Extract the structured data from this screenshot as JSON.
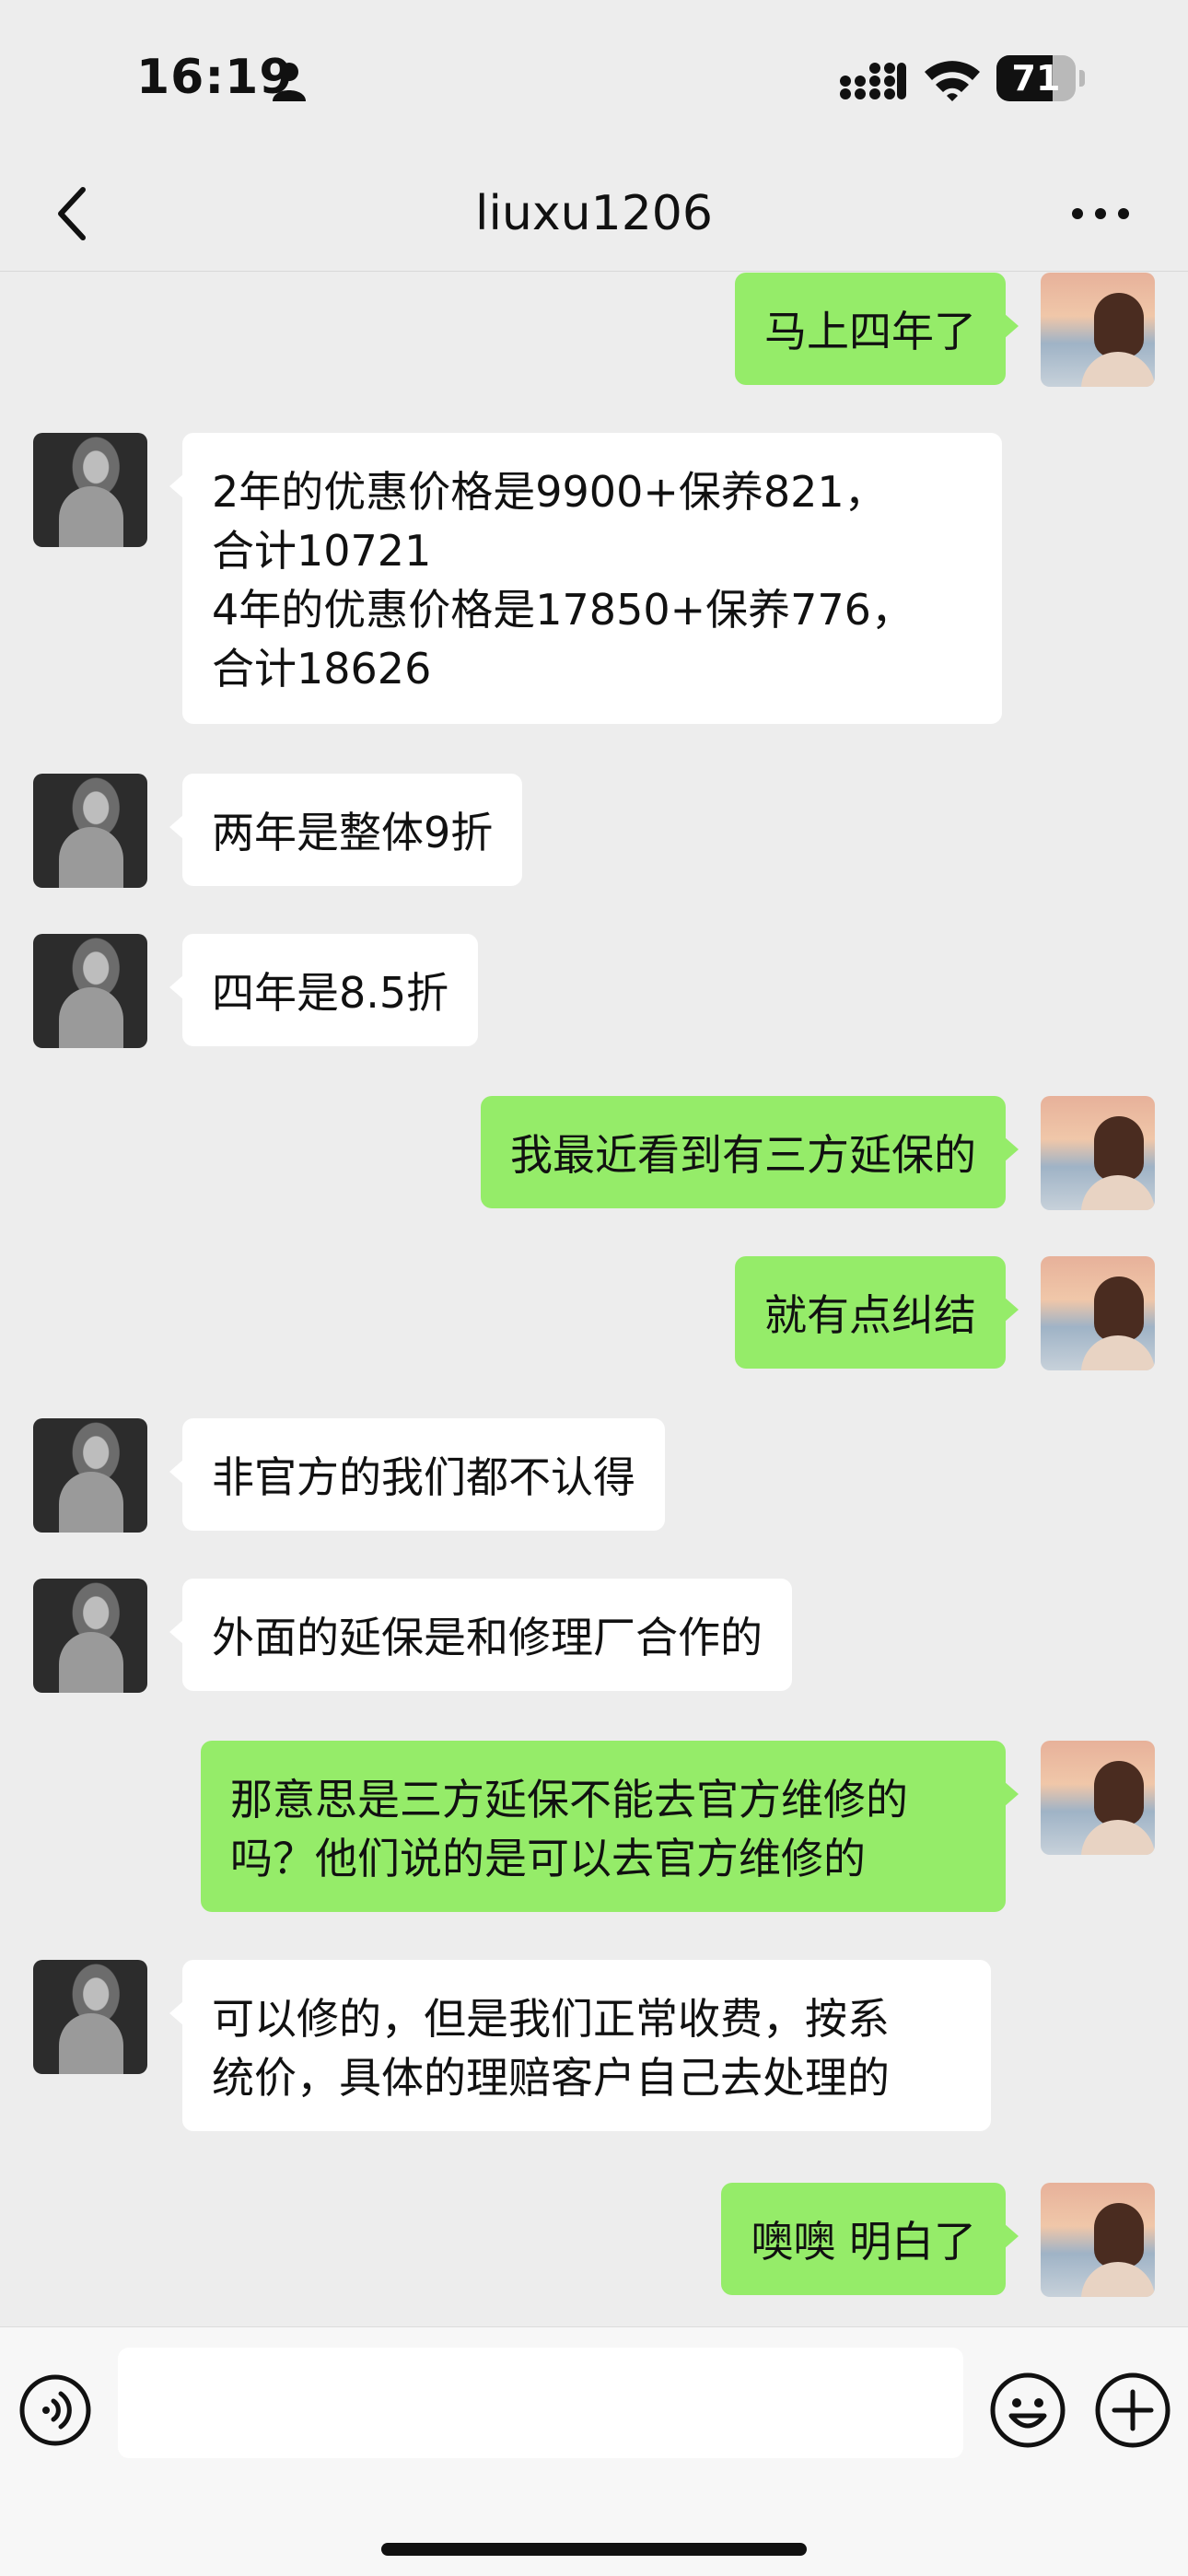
{
  "status_bar": {
    "time": "16:19",
    "battery_level": "71",
    "battery_fraction": 0.71
  },
  "nav": {
    "title": "liuxu1206"
  },
  "messages": [
    {
      "side": "out",
      "text": "马上四年了"
    },
    {
      "side": "in",
      "text": "2年的优惠价格是9900+保养821，\n合计10721\n4年的优惠价格是17850+保养776，\n合计18626"
    },
    {
      "side": "in",
      "text": "两年是整体9折"
    },
    {
      "side": "in",
      "text": "四年是8.5折"
    },
    {
      "side": "out",
      "text": "我最近看到有三方延保的"
    },
    {
      "side": "out",
      "text": "就有点纠结"
    },
    {
      "side": "in",
      "text": "非官方的我们都不认得"
    },
    {
      "side": "in",
      "text": "外面的延保是和修理厂合作的"
    },
    {
      "side": "out",
      "text": "那意思是三方延保不能去官方维修的\n吗？他们说的是可以去官方维修的"
    },
    {
      "side": "in",
      "text": "可以修的，但是我们正常收费，按系\n统价，具体的理赔客户自己去处理的"
    },
    {
      "side": "out",
      "text": "噢噢 明白了"
    }
  ],
  "input_bar": {
    "placeholder": "",
    "icons": [
      "voice-icon",
      "emoji-icon",
      "add-icon"
    ]
  },
  "colors": {
    "background": "#ededed",
    "outgoing_bubble": "#95ec69",
    "incoming_bubble": "#ffffff"
  }
}
